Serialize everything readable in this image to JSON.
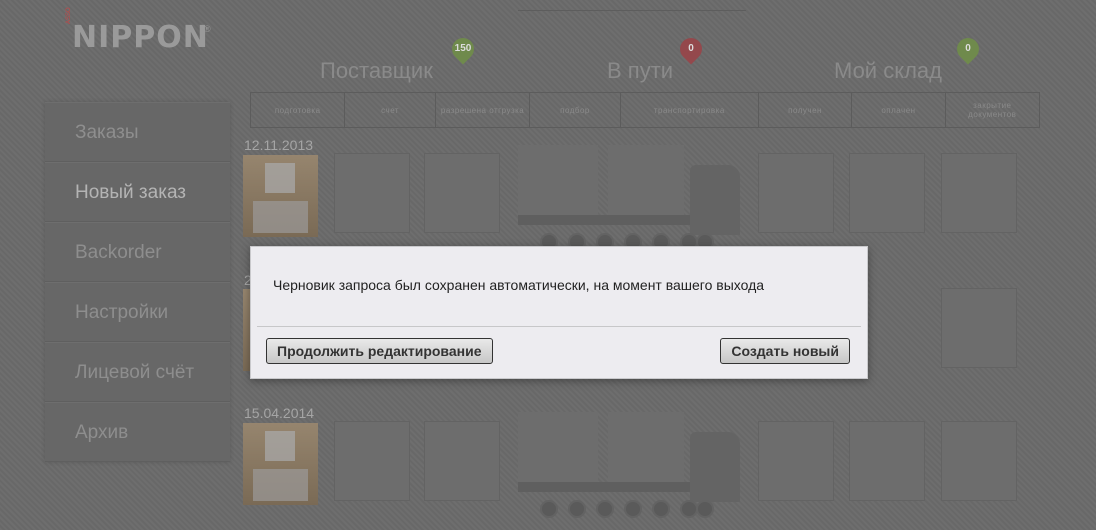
{
  "logo": {
    "small": "ASSO",
    "text": "NIPPON",
    "reg": "®"
  },
  "sidebar": {
    "items": [
      {
        "label": "Заказы"
      },
      {
        "label": "Новый заказ"
      },
      {
        "label": "Backorder"
      },
      {
        "label": "Настройки"
      },
      {
        "label": "Лицевой счёт"
      },
      {
        "label": "Архив"
      }
    ]
  },
  "stages": [
    {
      "title": "Поставщик",
      "count": "150",
      "color": "#6f8a4c"
    },
    {
      "title": "В пути",
      "count": "0",
      "color": "#94484c"
    },
    {
      "title": "Мой склад",
      "count": "0",
      "color": "#6f8a4c"
    }
  ],
  "steps": [
    "подготовка",
    "счет",
    "разрешена отгрузка",
    "подбор",
    "транспортировка",
    "получен",
    "оплачен",
    "закрытие документов"
  ],
  "orders": [
    {
      "date": "12.11.2013"
    },
    {
      "date": "2"
    },
    {
      "date": "15.04.2014"
    }
  ],
  "modal": {
    "message": "Черновик запроса был сохранен автоматически, на момент вашего выхода",
    "continue_label": "Продолжить редактирование",
    "create_label": "Создать новый"
  }
}
